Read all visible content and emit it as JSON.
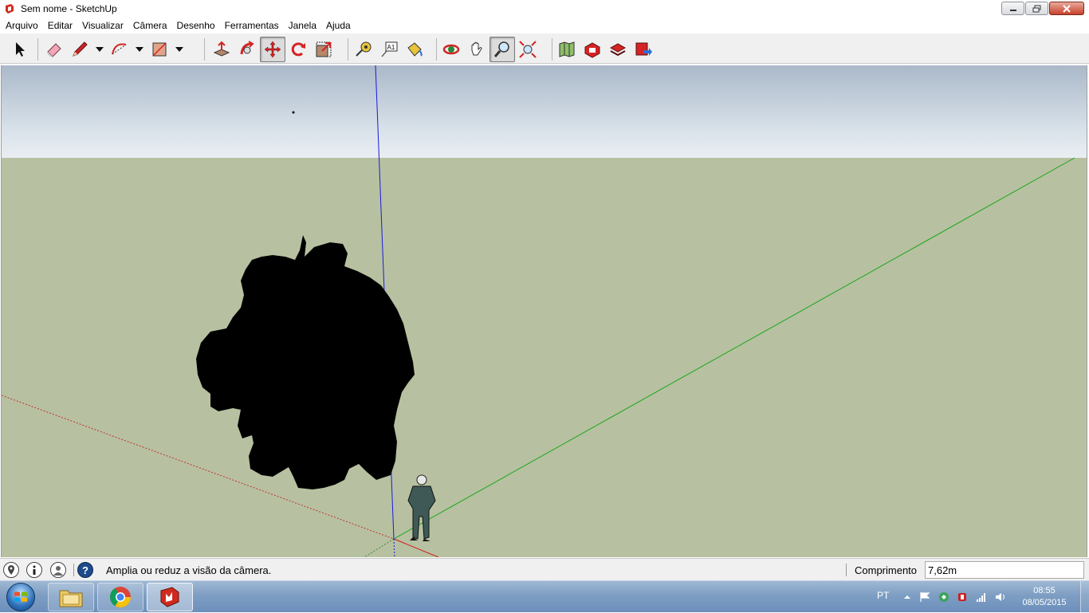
{
  "window": {
    "title": "Sem nome - SketchUp"
  },
  "menu": {
    "items": [
      "Arquivo",
      "Editar",
      "Visualizar",
      "Câmera",
      "Desenho",
      "Ferramentas",
      "Janela",
      "Ajuda"
    ]
  },
  "toolbar": {
    "tools": [
      {
        "icon": "select-arrow-icon",
        "active": false
      },
      {
        "icon": "eraser-icon",
        "active": false
      },
      {
        "icon": "pencil-line-icon",
        "active": false,
        "has_dropdown": true
      },
      {
        "icon": "arc-icon",
        "active": false,
        "has_dropdown": true
      },
      {
        "icon": "rectangle-icon",
        "active": false,
        "has_dropdown": true
      },
      {
        "icon": "push-pull-icon",
        "active": false
      },
      {
        "icon": "follow-me-icon",
        "active": false
      },
      {
        "icon": "move-icon",
        "active": true
      },
      {
        "icon": "rotate-icon",
        "active": false
      },
      {
        "icon": "scale-icon",
        "active": false
      },
      {
        "icon": "tape-measure-icon",
        "active": false
      },
      {
        "icon": "text-label-icon",
        "active": false,
        "label": "A1"
      },
      {
        "icon": "paint-bucket-icon",
        "active": false
      },
      {
        "icon": "orbit-icon",
        "active": false
      },
      {
        "icon": "pan-hand-icon",
        "active": false
      },
      {
        "icon": "zoom-icon",
        "active": true
      },
      {
        "icon": "zoom-extents-icon",
        "active": false
      },
      {
        "icon": "add-location-icon",
        "active": false
      },
      {
        "icon": "3d-warehouse-icon",
        "active": false
      },
      {
        "icon": "share-model-icon",
        "active": false
      },
      {
        "icon": "extension-warehouse-icon",
        "active": false
      }
    ]
  },
  "statusbar": {
    "icons": [
      "geolocation-icon",
      "credits-info-icon",
      "user-account-icon",
      "help-icon"
    ],
    "message": "Amplia ou reduz a visão da câmera.",
    "measurement_label": "Comprimento",
    "measurement_value": "7,62m"
  },
  "taskbar": {
    "apps": [
      "windows-explorer-icon",
      "chrome-icon",
      "sketchup-icon"
    ],
    "active_app": "sketchup-icon",
    "language": "PT",
    "time": "08:55",
    "date": "08/05/2015"
  },
  "colors": {
    "sky_top": "#aab8c9",
    "ground": "#b7c1a1",
    "axis_blue": "#1a1adb",
    "axis_green": "#1aa61a",
    "axis_red": "#d11a1a"
  }
}
